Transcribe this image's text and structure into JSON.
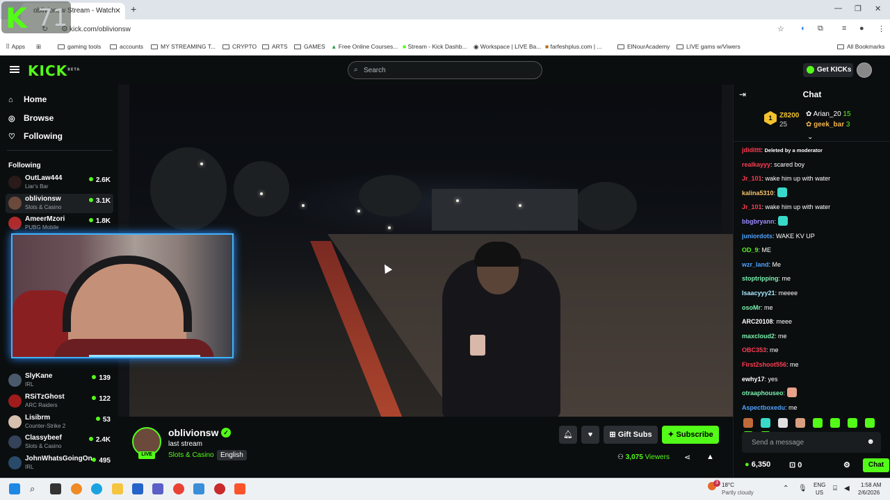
{
  "browser": {
    "tab_title": "oblivionsw Stream - Watch",
    "url": "kick.com/oblivionsw",
    "overlay_number": "71",
    "bookmarks": [
      "Apps",
      "gaming tools",
      "accounts",
      "MY STREAMING T...",
      "CRYPTO",
      "ARTS",
      "GAMES",
      "Free Online Courses...",
      "Stream - Kick Dashb...",
      "Workspace | LIVE Ba...",
      "farfeshplus.com | ...",
      "ElNourAcademy",
      "LIVE gams w/Viwers",
      "All Bookmarks"
    ]
  },
  "header": {
    "logo": "KICK",
    "logo_beta": "BETA",
    "search_placeholder": "Search",
    "get_kicks": "Get KICKs"
  },
  "sidebar": {
    "nav": [
      {
        "label": "Home",
        "icon": "home-icon"
      },
      {
        "label": "Browse",
        "icon": "compass-icon"
      },
      {
        "label": "Following",
        "icon": "heart-icon"
      }
    ],
    "following_header": "Following",
    "channels": [
      {
        "name": "OutLaw444",
        "category": "Liar's Bar",
        "viewers": "2.6K"
      },
      {
        "name": "oblivionsw",
        "category": "Slots & Casino",
        "viewers": "3.1K"
      },
      {
        "name": "AmeerMzori",
        "category": "PUBG Mobile",
        "viewers": "1.8K"
      },
      {
        "name": "SlyKane",
        "category": "IRL",
        "viewers": "139"
      },
      {
        "name": "RSiTzGhost",
        "category": "ARC Raiders",
        "viewers": "122"
      },
      {
        "name": "Lisibrm",
        "category": "Counter-Strike 2",
        "viewers": "53"
      },
      {
        "name": "Classybeef",
        "category": "Slots & Casino",
        "viewers": "2.4K"
      },
      {
        "name": "JohnWhatsGoingOn",
        "category": "IRL",
        "viewers": "495"
      }
    ]
  },
  "stream": {
    "streamer": "oblivionsw",
    "live": "LIVE",
    "title": "last stream",
    "category": "Slots & Casino",
    "language": "English",
    "gift_subs": "Gift Subs",
    "subscribe": "Subscribe",
    "viewers_count": "3,075",
    "viewers_label": "Viewers"
  },
  "chat": {
    "title": "Chat",
    "pinned": {
      "rank": "1",
      "top_user": "Z8200",
      "top_count": "25",
      "user2": "Arian_20",
      "user2_count": "15",
      "user3": "geek_bar",
      "user3_count": "3"
    },
    "messages": [
      {
        "user": "jdidittt",
        "color": "#ff3c52",
        "text": "Deleted by a moderator",
        "deleted": true
      },
      {
        "user": "realkayyy",
        "color": "#ff3c52",
        "text": "scared boy"
      },
      {
        "user": "Jr_101",
        "color": "#ff3c52",
        "text": "wake him up with water"
      },
      {
        "user": "kalina5310",
        "color": "#f5c26b",
        "text": "",
        "emote": "#38d9c9"
      },
      {
        "user": "Jr_101",
        "color": "#ff3c52",
        "text": "wake him up with water"
      },
      {
        "user": "bbgbryann",
        "color": "#9b8cff",
        "text": "",
        "emote": "#38d9c9"
      },
      {
        "user": "juniordots",
        "color": "#4fa3ff",
        "text": "WAKE KV UP"
      },
      {
        "user": "OD_9",
        "color": "#53fc18",
        "text": "ME"
      },
      {
        "user": "wzr_land",
        "color": "#4fa3ff",
        "text": "Me"
      },
      {
        "user": "stoptripping",
        "color": "#7bf2b0",
        "text": "me"
      },
      {
        "user": "Isaacyyy21",
        "color": "#a8e8ff",
        "text": "meeee"
      },
      {
        "user": "osoMr",
        "color": "#7bf2b0",
        "text": "me"
      },
      {
        "user": "ARC20108",
        "color": "#ffffff",
        "text": "meee"
      },
      {
        "user": "maxcloud2",
        "color": "#7bf2b0",
        "text": "me"
      },
      {
        "user": "OBC353",
        "color": "#ff3c52",
        "text": "me"
      },
      {
        "user": "First2shoot556",
        "color": "#ff3c52",
        "text": "me"
      },
      {
        "user": "ewhy17",
        "color": "#ffffff",
        "text": "yes"
      },
      {
        "user": "otraaphouseo",
        "color": "#7bf2b0",
        "text": "",
        "emote": "#e8a08a"
      },
      {
        "user": "Aspectboxedu",
        "color": "#4fa3ff",
        "text": "me"
      }
    ],
    "input_placeholder": "Send a message",
    "kicks_balance": "6,350",
    "points": "0",
    "send_label": "Chat"
  },
  "taskbar": {
    "temp": "18°C",
    "weather": "Partly cloudy",
    "lang_line1": "ENG",
    "lang_line2": "US",
    "time": "1:58 AM",
    "date": "2/6/2026",
    "notifications": "3"
  }
}
